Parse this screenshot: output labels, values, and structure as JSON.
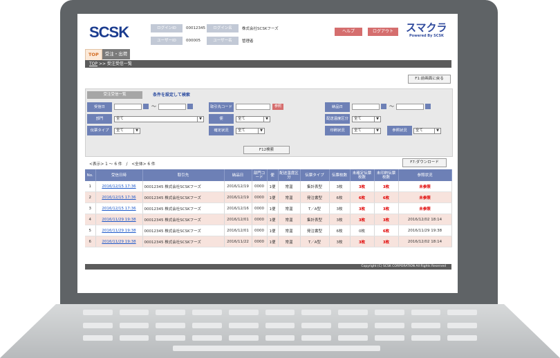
{
  "header": {
    "logo": "SCSK",
    "login_id_label": "ログインID",
    "login_id_value": "00012345",
    "login_name_label": "ログイン名",
    "login_name_value": "株式会社SCSKフーズ",
    "user_id_label": "ユーザーID",
    "user_id_value": "000005",
    "user_name_label": "ユーザー名",
    "user_name_value": "管理者",
    "help_label": "ヘルプ",
    "logout_label": "ログアウト",
    "brand": "スマクラ",
    "brand_sub": "Powered By SCSK"
  },
  "tabs": [
    {
      "label": "TOP"
    },
    {
      "label": "受注・出荷"
    }
  ],
  "breadcrumb": {
    "root": "TOP",
    "sep": ">>",
    "current": "受注受信一覧"
  },
  "buttons": {
    "back": "F1:前画面に戻る",
    "search": "F12検索",
    "download": "F7:ダウンロード",
    "ref": "参照"
  },
  "search": {
    "tab_list": "受注受信一覧",
    "tab_conditions": "条件を設定して検索",
    "tilde": "～",
    "labels": {
      "recv_date": "受信日",
      "partner_code": "取引先コード",
      "delivery_date": "納品日",
      "dept": "部門",
      "bin": "便",
      "temp": "配送温度区分",
      "slip_type": "伝票タイプ",
      "confirm": "確定状況",
      "print": "印刷状況",
      "ref_status": "参照状況"
    },
    "values": {
      "dept": "全て",
      "bin": "全て",
      "temp": "全て",
      "slip_type": "全て",
      "confirm": "全て",
      "print": "全て",
      "ref_status": "全て"
    }
  },
  "result": {
    "display_info": "<表示> 1 ～ 6 件　/　<全体> 6 件"
  },
  "table": {
    "headers": [
      "No.",
      "受信日時",
      "取引先",
      "納品日",
      "部門コード",
      "便",
      "配送温度区分",
      "伝票タイプ",
      "伝票枚数",
      "未確定伝票枚数",
      "未印刷伝票枚数",
      "参照状況"
    ],
    "rows": [
      [
        "1",
        "2016/12/15 17:36",
        "00012345 株式会社SCSKフーズ",
        "2016/12/19",
        "0000",
        "1便",
        "常温",
        "集計表型",
        "3枚",
        "3枚",
        "3枚",
        "未参照"
      ],
      [
        "2",
        "2016/12/15 17:36",
        "00012345 株式会社SCSKフーズ",
        "2016/12/19",
        "0000",
        "1便",
        "常温",
        "発注書型",
        "6枚",
        "6枚",
        "6枚",
        "未参照"
      ],
      [
        "3",
        "2016/12/15 17:36",
        "00012345 株式会社SCSKフーズ",
        "2016/12/16",
        "0000",
        "1便",
        "常温",
        "T／A型",
        "3枚",
        "3枚",
        "3枚",
        "未参照"
      ],
      [
        "4",
        "2016/11/29 19:38",
        "00012345 株式会社SCSKフーズ",
        "2016/12/01",
        "0000",
        "1便",
        "常温",
        "集計表型",
        "3枚",
        "3枚",
        "3枚",
        "2016/12/02 18:14"
      ],
      [
        "5",
        "2016/11/29 19:38",
        "00012345 株式会社SCSKフーズ",
        "2016/12/01",
        "0000",
        "1便",
        "常温",
        "発注書型",
        "6枚",
        "0枚",
        "6枚",
        "2016/11/29 19:38"
      ],
      [
        "6",
        "2016/11/29 19:38",
        "00012345 株式会社SCSKフーズ",
        "2016/11/22",
        "0000",
        "1便",
        "常温",
        "T／A型",
        "3枚",
        "3枚",
        "3枚",
        "2016/12/02 18:14"
      ]
    ]
  },
  "footer": {
    "copyright": "Copyright (C) SCSK CORPORATION All Rights Reserved"
  },
  "colors": {
    "accent": "#6d80b6",
    "danger": "#e00000",
    "logo": "#1b3c8f"
  }
}
